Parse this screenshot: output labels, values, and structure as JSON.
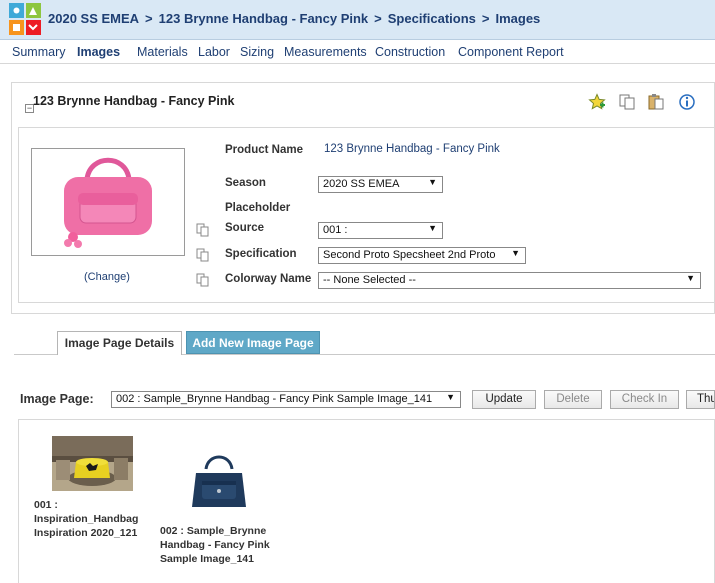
{
  "breadcrumb": {
    "items": [
      "2020 SS EMEA",
      "123 Brynne Handbag - Fancy Pink",
      "Specifications",
      "Images"
    ],
    "separator": ">"
  },
  "menu": {
    "items": [
      "Summary",
      "Images",
      "Materials",
      "Labor",
      "Sizing",
      "Measurements",
      "Construction",
      "Component Report"
    ],
    "active": "Images"
  },
  "product": {
    "title": "123 Brynne Handbag - Fancy Pink",
    "change_link": "(Change)",
    "fields": {
      "product_name_label": "Product Name",
      "product_name_value": "123 Brynne Handbag - Fancy Pink",
      "season_label": "Season",
      "season_value": "2020 SS EMEA",
      "placeholder_label": "Placeholder",
      "source_label": "Source",
      "source_value": "001 :",
      "specification_label": "Specification",
      "specification_value": "Second Proto Specsheet 2nd Proto",
      "colorway_label": "Colorway Name",
      "colorway_value": "-- None Selected --"
    }
  },
  "tabs": {
    "details": "Image Page Details",
    "add_new": "Add New Image Page"
  },
  "image_page": {
    "label": "Image Page:",
    "selected": "002 : Sample_Brynne Handbag - Fancy Pink Sample Image_141",
    "buttons": {
      "update": "Update",
      "delete": "Delete",
      "check_in": "Check In",
      "thumb": "Thu"
    }
  },
  "gallery": {
    "items": [
      {
        "caption_line1": "001 :",
        "caption_line2": "Inspiration_Handbag",
        "caption_line3": "Inspiration 2020_121"
      },
      {
        "caption_line1": "002 : Sample_Brynne",
        "caption_line2": "Handbag - Fancy Pink",
        "caption_line3": "Sample Image_141"
      }
    ]
  },
  "colors": {
    "header_bg": "#d9e8f5",
    "link": "#1f3f73",
    "tab_active_bg": "#5fa8c7",
    "bag_pink": "#ef6fa6",
    "bag_navy": "#1f3a5c"
  },
  "icons": [
    "favorite-star-icon",
    "copy-icon",
    "paste-icon",
    "info-icon",
    "collapse-icon"
  ]
}
